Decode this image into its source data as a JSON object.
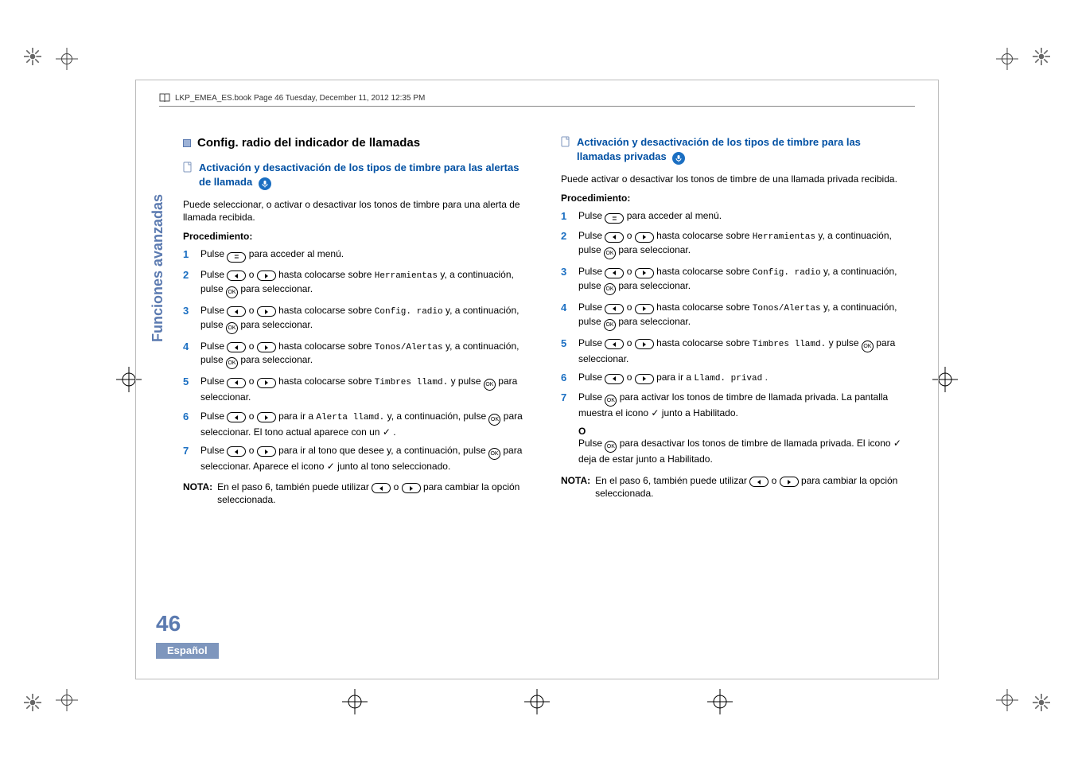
{
  "running_head": "LKP_EMEA_ES.book  Page 46  Tuesday, December 11, 2012  12:35 PM",
  "tab_label": "Funciones avanzadas",
  "page_number": "46",
  "language": "Español",
  "left": {
    "section_title": "Config. radio del indicador de llamadas",
    "sub_title": "Activación y desactivación de los tipos de timbre para las alertas de llamada",
    "intro": "Puede seleccionar, o activar o desactivar los tonos de timbre para una alerta de llamada recibida.",
    "proc_label": "Procedimiento:",
    "steps": {
      "s1a": "Pulse ",
      "s1b": " para acceder al menú.",
      "s2a": "Pulse ",
      "s2b": " o ",
      "s2c": " hasta colocarse sobre ",
      "s2m": "Herramientas",
      "s2d": " y, a continuación, pulse ",
      "s2e": " para seleccionar.",
      "s3m": "Config. radio",
      "s4m": "Tonos/Alertas",
      "s5a": "Pulse ",
      "s5b": " o ",
      "s5c": " hasta colocarse sobre ",
      "s5m": "Timbres llamd.",
      "s5d": " y pulse ",
      "s5e": " para seleccionar.",
      "s6a": "Pulse ",
      "s6b": " o ",
      "s6c": " para ir a ",
      "s6m": "Alerta llamd.",
      "s6d": " y, a continuación, pulse ",
      "s6e": " para seleccionar. El tono actual aparece con un ",
      "s6f": ".",
      "s7a": "Pulse ",
      "s7b": " o ",
      "s7c": " para ir al tono que desee y, a continuación, pulse ",
      "s7d": " para seleccionar. Aparece el icono ",
      "s7e": " junto al tono seleccionado."
    },
    "note_label": "NOTA:",
    "note_a": "En el paso 6, también puede utilizar ",
    "note_b": " o ",
    "note_c": " para cambiar la opción seleccionada."
  },
  "right": {
    "sub_title": "Activación y desactivación de los tipos de timbre para las llamadas privadas",
    "intro": "Puede activar o desactivar los tonos de timbre de una llamada privada recibida.",
    "proc_label": "Procedimiento:",
    "steps": {
      "s1a": "Pulse ",
      "s1b": " para acceder al menú.",
      "s2m": "Herramientas",
      "s3m": "Config. radio",
      "s4m": "Tonos/Alertas",
      "s5m": "Timbres llamd.",
      "s5a": "Pulse ",
      "s5b": " o ",
      "s5c": " hasta colocarse sobre ",
      "s5d": " y pulse ",
      "s5e": " para seleccionar.",
      "s6a": "Pulse ",
      "s6b": " o ",
      "s6c": " para ir a ",
      "s6m": "Llamd. privad",
      "s6d": ".",
      "s7a": "Pulse ",
      "s7b": " para activar los tonos de timbre de llamada privada. La pantalla muestra el icono ",
      "s7c": " junto a Habilitado.",
      "or": "O",
      "s7d": "Pulse ",
      "s7e": " para desactivar los tonos de timbre de llamada privada. El icono ",
      "s7f": " deja de estar junto a Habilitado."
    },
    "note_label": "NOTA:",
    "note_a": "En el paso 6, también puede utilizar ",
    "note_b": " o ",
    "note_c": " para cambiar la opción seleccionada."
  },
  "common": {
    "s234_a": "Pulse ",
    "s234_b": " o ",
    "s234_c": " hasta colocarse sobre ",
    "s234_d": " y, a continuación, pulse ",
    "s234_e": " para seleccionar."
  },
  "keys": {
    "ok": "OK",
    "menu": "≣"
  },
  "check": "✓"
}
